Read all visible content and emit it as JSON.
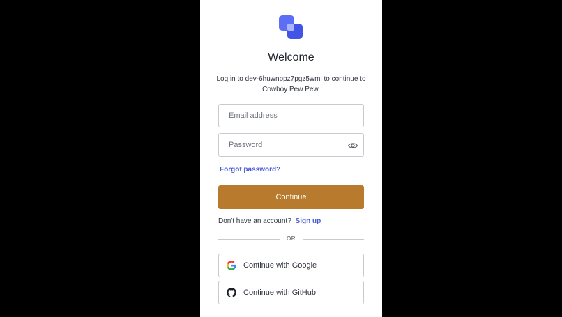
{
  "login": {
    "title": "Welcome",
    "subtitle": "Log in to dev-6huwnppz7pgz5wml to continue to Cowboy Pew Pew.",
    "email_placeholder": "Email address",
    "password_placeholder": "Password",
    "forgot_password": "Forgot password?",
    "continue_label": "Continue",
    "no_account_text": "Don't have an account?",
    "signup_label": "Sign up",
    "divider_text": "OR",
    "google_label": "Continue with Google",
    "github_label": "Continue with GitHub"
  },
  "colors": {
    "accent_button": "#b87a2c",
    "link": "#4a5bd6",
    "logo": "#5b6ef5"
  },
  "icons": {
    "logo": "overlapping-squares-logo",
    "password_toggle": "eye-icon",
    "google": "google-icon",
    "github": "github-icon"
  }
}
